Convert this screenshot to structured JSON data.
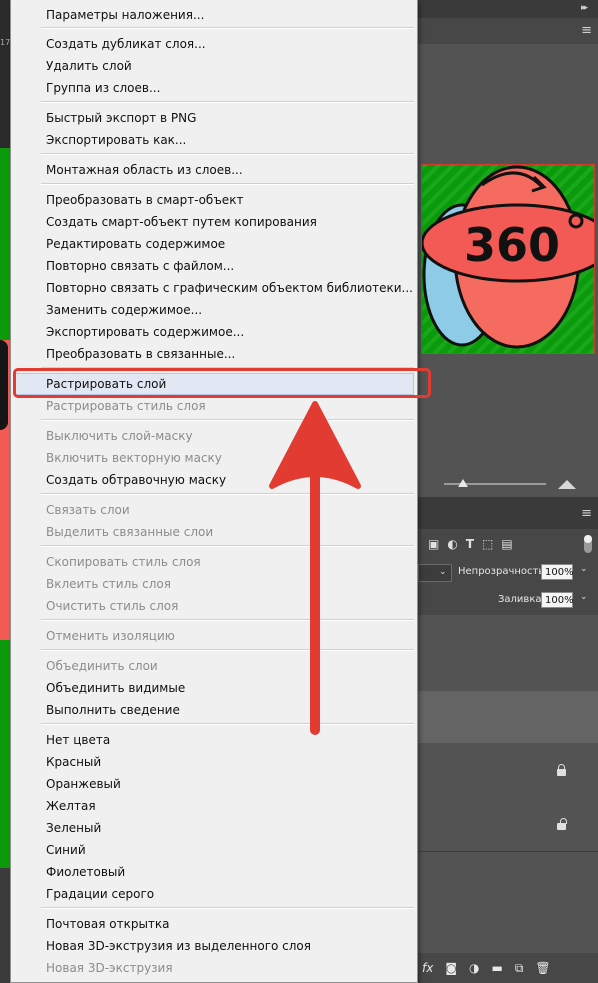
{
  "colors": {
    "accent_red": "#e23b32",
    "canvas_green": "#0b9a0b",
    "image_red": "#f35a55",
    "menu_bg": "#f0f0f0",
    "panel_bg": "#535353"
  },
  "canvas": {
    "tab_fragment": "17"
  },
  "preview": {
    "icon_text": "360"
  },
  "layers_panel": {
    "opacity_label": "Непрозрачность:",
    "opacity_value": "100%",
    "fill_label": "Заливка:",
    "fill_value": "100%",
    "fx_label": "fx",
    "filter_icons": [
      "image-filter-icon",
      "adjustment-filter-icon",
      "type-filter-icon",
      "shape-filter-icon",
      "smart-object-filter-icon"
    ],
    "bottom_icons": [
      "link-icon",
      "fx-icon",
      "mask-icon",
      "adjustment-icon",
      "folder-icon",
      "new-layer-icon",
      "trash-icon"
    ]
  },
  "context_menu": {
    "groups": [
      [
        {
          "label": "Параметры наложения...",
          "enabled": true
        }
      ],
      [
        {
          "label": "Создать дубликат слоя...",
          "enabled": true
        },
        {
          "label": "Удалить слой",
          "enabled": true
        },
        {
          "label": "Группа из слоев...",
          "enabled": true
        }
      ],
      [
        {
          "label": "Быстрый экспорт в PNG",
          "enabled": true
        },
        {
          "label": "Экспортировать как...",
          "enabled": true
        }
      ],
      [
        {
          "label": "Монтажная область из слоев...",
          "enabled": true
        }
      ],
      [
        {
          "label": "Преобразовать в смарт-объект",
          "enabled": true
        },
        {
          "label": "Создать смарт-объект путем копирования",
          "enabled": true
        },
        {
          "label": "Редактировать содержимое",
          "enabled": true
        },
        {
          "label": "Повторно связать с файлом...",
          "enabled": true
        },
        {
          "label": "Повторно связать с графическим объектом библиотеки...",
          "enabled": true
        },
        {
          "label": "Заменить содержимое...",
          "enabled": true
        },
        {
          "label": "Экспортировать содержимое...",
          "enabled": true
        },
        {
          "label": "Преобразовать в связанные...",
          "enabled": true
        }
      ],
      [
        {
          "label": "Растрировать слой",
          "enabled": true,
          "highlighted": true
        },
        {
          "label": "Растрировать стиль слоя",
          "enabled": false
        }
      ],
      [
        {
          "label": "Выключить слой-маску",
          "enabled": false
        },
        {
          "label": "Включить векторную маску",
          "enabled": false
        },
        {
          "label": "Создать обтравочную маску",
          "enabled": true
        }
      ],
      [
        {
          "label": "Связать слои",
          "enabled": false
        },
        {
          "label": "Выделить связанные слои",
          "enabled": false
        }
      ],
      [
        {
          "label": "Скопировать стиль слоя",
          "enabled": false
        },
        {
          "label": "Вклеить стиль слоя",
          "enabled": false
        },
        {
          "label": "Очистить стиль слоя",
          "enabled": false
        }
      ],
      [
        {
          "label": "Отменить изоляцию",
          "enabled": false
        }
      ],
      [
        {
          "label": "Объединить слои",
          "enabled": false
        },
        {
          "label": "Объединить видимые",
          "enabled": true
        },
        {
          "label": "Выполнить сведение",
          "enabled": true
        }
      ],
      [
        {
          "label": "Нет цвета",
          "enabled": true
        },
        {
          "label": "Красный",
          "enabled": true
        },
        {
          "label": "Оранжевый",
          "enabled": true
        },
        {
          "label": "Желтая",
          "enabled": true
        },
        {
          "label": "Зеленый",
          "enabled": true
        },
        {
          "label": "Синий",
          "enabled": true
        },
        {
          "label": "Фиолетовый",
          "enabled": true
        },
        {
          "label": "Градации серого",
          "enabled": true
        }
      ],
      [
        {
          "label": "Почтовая открытка",
          "enabled": true
        },
        {
          "label": "Новая 3D-экструзия из выделенного слоя",
          "enabled": true
        },
        {
          "label": "Новая 3D-экструзия",
          "enabled": false
        }
      ]
    ]
  }
}
